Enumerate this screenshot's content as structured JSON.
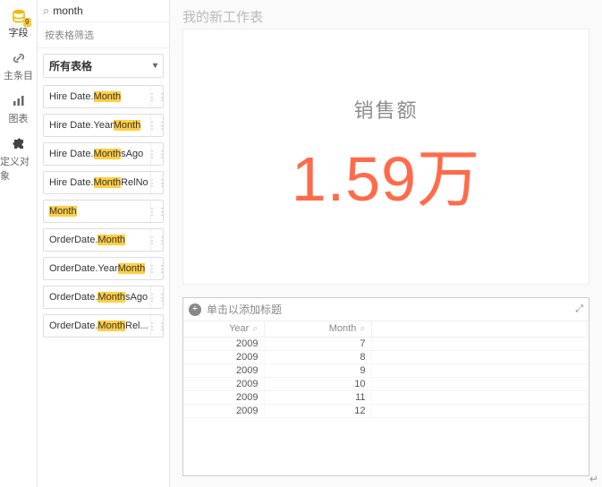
{
  "rail": {
    "items": [
      {
        "name": "fields",
        "label": "字段",
        "badge": "9"
      },
      {
        "name": "links",
        "label": "主条目"
      },
      {
        "name": "charts",
        "label": "图表"
      },
      {
        "name": "custom",
        "label": "定义对象"
      }
    ]
  },
  "search": {
    "value": "month",
    "icon_glyph": "⌕",
    "clear_glyph": "×"
  },
  "filter_hint": "按表格筛选",
  "table_select": {
    "label": "所有表格"
  },
  "fields": [
    {
      "prefix": "Hire Date.",
      "hl": "Month",
      "suffix": ""
    },
    {
      "prefix": "Hire Date.Year",
      "hl": "Month",
      "suffix": ""
    },
    {
      "prefix": "Hire Date.",
      "hl": "Month",
      "suffix": "sAgo"
    },
    {
      "prefix": "Hire Date.",
      "hl": "Month",
      "suffix": "RelNo"
    },
    {
      "prefix": "",
      "hl": "Month",
      "suffix": ""
    },
    {
      "prefix": "OrderDate.",
      "hl": "Month",
      "suffix": ""
    },
    {
      "prefix": "OrderDate.Year",
      "hl": "Month",
      "suffix": ""
    },
    {
      "prefix": "OrderDate.",
      "hl": "Month",
      "suffix": "sAgo"
    },
    {
      "prefix": "OrderDate.",
      "hl": "Month",
      "suffix": "Rel..."
    }
  ],
  "sheet_title": "我的新工作表",
  "kpi": {
    "label": "销售额",
    "value": "1.59万"
  },
  "table": {
    "title_placeholder": "单击以添加标题",
    "columns": [
      "Year",
      "Month"
    ],
    "rows": [
      [
        "2009",
        "7"
      ],
      [
        "2009",
        "8"
      ],
      [
        "2009",
        "9"
      ],
      [
        "2009",
        "10"
      ],
      [
        "2009",
        "11"
      ],
      [
        "2009",
        "12"
      ]
    ]
  },
  "chart_data": {
    "type": "table",
    "columns": [
      "Year",
      "Month"
    ],
    "rows": [
      [
        2009,
        7
      ],
      [
        2009,
        8
      ],
      [
        2009,
        9
      ],
      [
        2009,
        10
      ],
      [
        2009,
        11
      ],
      [
        2009,
        12
      ]
    ],
    "kpi": {
      "label": "销售额",
      "value_text": "1.59万",
      "value": 15900
    }
  },
  "carriage": "↵"
}
